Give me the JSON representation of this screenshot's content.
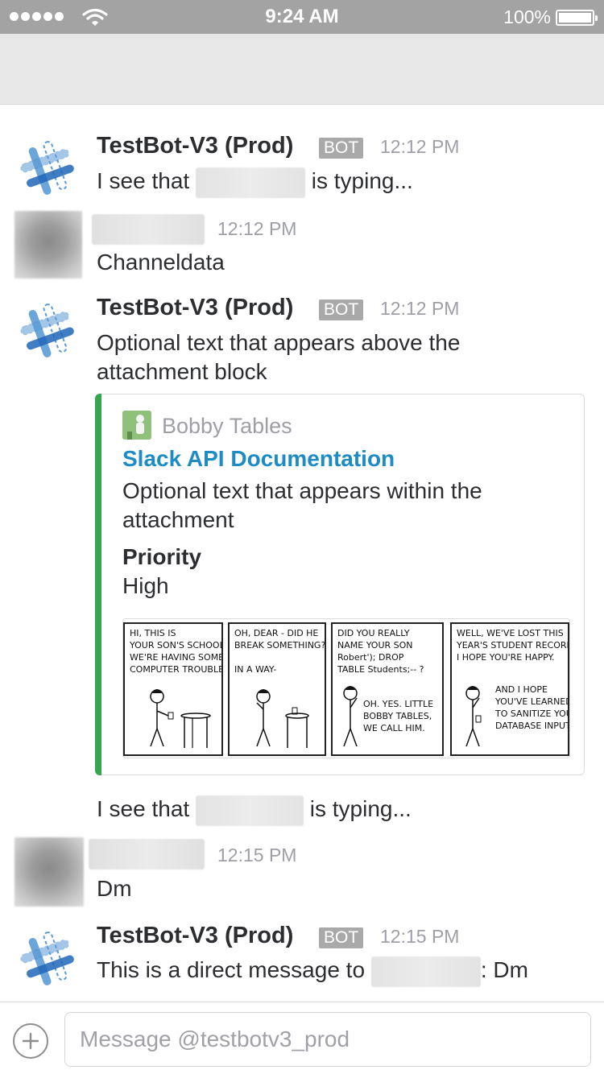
{
  "status_bar": {
    "time": "9:24 AM",
    "battery": "100%",
    "battery_level": 1.0,
    "signal_bars": 5
  },
  "colors": {
    "accent_link": "#1d8cc4",
    "attachment_bar": "#36a64f",
    "bot_badge": "#a9a9a9"
  },
  "messages": [
    {
      "sender": "TestBot-V3 (Prod)",
      "badge": "BOT",
      "time": "12:12 PM",
      "text_before": "I see that",
      "text_after": "is typing..."
    },
    {
      "sender": "",
      "time": "12:12 PM",
      "text": "Channeldata"
    },
    {
      "sender": "TestBot-V3 (Prod)",
      "badge": "BOT",
      "time": "12:12 PM",
      "text": "Optional text that appears above the attachment block",
      "attachment": {
        "author_name": "Bobby Tables",
        "title": "Slack API Documentation",
        "text": "Optional text that appears within the attachment",
        "field_title": "Priority",
        "field_value": "High",
        "comic_panels": [
          "HI, THIS IS\nYOUR SON'S SCHOOL.\nWE'RE HAVING SOME\nCOMPUTER TROUBLE.",
          "OH, DEAR - DID HE\nBREAK SOMETHING?\n\nIN A WAY-",
          "DID YOU REALLY\nNAME YOUR SON\nRobert'); DROP\nTABLE Students;-- ?",
          "WELL, WE'VE LOST THIS\nYEAR'S STUDENT RECORDS.\nI HOPE YOU'RE HAPPY."
        ],
        "comic_panel3_reply": "OH. YES. LITTLE\nBOBBY TABLES,\nWE CALL HIM.",
        "comic_panel4_reply": "AND I HOPE\nYOU'VE LEARNED\nTO SANITIZE YOUR\nDATABASE INPUTS."
      },
      "followup_before": "I see that",
      "followup_after": "is typing..."
    },
    {
      "sender": "",
      "time": "12:15 PM",
      "text": "Dm"
    },
    {
      "sender": "TestBot-V3 (Prod)",
      "badge": "BOT",
      "time": "12:15 PM",
      "text_before": "This is a direct message to",
      "text_after": ": Dm"
    }
  ],
  "composer": {
    "placeholder": "Message @testbotv3_prod",
    "value": ""
  },
  "icons": {
    "bot_avatar": "slack-hash-icon",
    "add": "plus-icon",
    "wifi": "wifi-icon",
    "battery": "battery-icon"
  }
}
